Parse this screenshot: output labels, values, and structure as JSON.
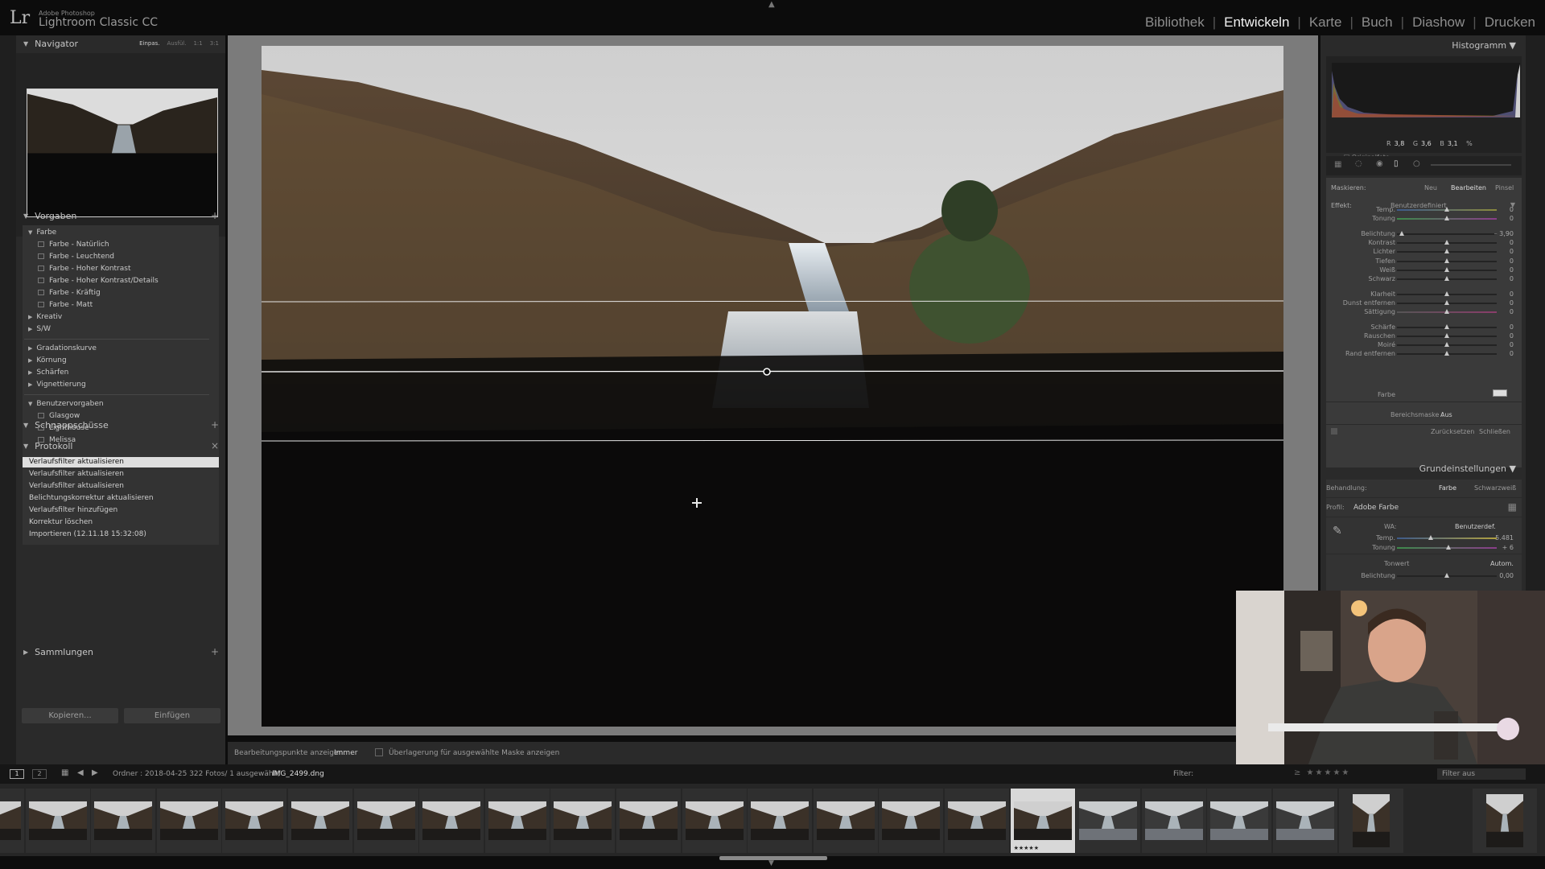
{
  "app": {
    "logo": "Lr",
    "brand_sub": "Adobe Photoshop",
    "brand_main": "Lightroom Classic CC"
  },
  "modules": [
    "Bibliothek",
    "Entwickeln",
    "Karte",
    "Buch",
    "Diashow",
    "Drucken"
  ],
  "active_module": "Entwickeln",
  "left_panel": {
    "navigator": {
      "title": "Navigator",
      "options": [
        "Einpas.",
        "Ausfül.",
        "1:1",
        "3:1"
      ]
    },
    "presets": {
      "title": "Vorgaben",
      "groups": [
        {
          "label": "Farbe",
          "items": [
            "Farbe - Natürlich",
            "Farbe - Leuchtend",
            "Farbe - Hoher Kontrast",
            "Farbe - Hoher Kontrast/Details",
            "Farbe - Kräftig",
            "Farbe - Matt"
          ]
        },
        {
          "label": "Kreativ"
        },
        {
          "label": "S/W"
        },
        {
          "label": "Gradationskurve"
        },
        {
          "label": "Körnung"
        },
        {
          "label": "Schärfen"
        },
        {
          "label": "Vignettierung"
        },
        {
          "label": "Benutzervorgaben",
          "items": [
            "Glasgow",
            "Lighthouse",
            "Melissa"
          ]
        }
      ]
    },
    "snapshots": {
      "title": "Schnappschüsse"
    },
    "history": {
      "title": "Protokoll",
      "items": [
        "Verlaufsfilter aktualisieren",
        "Verlaufsfilter aktualisieren",
        "Verlaufsfilter aktualisieren",
        "Belichtungskorrektur aktualisieren",
        "Verlaufsfilter hinzufügen",
        "Korrektur löschen",
        "Importieren (12.11.18 15:32:08)"
      ]
    },
    "collections": {
      "title": "Sammlungen"
    },
    "copy_button": "Kopieren...",
    "paste_button": "Einfügen"
  },
  "toolbar": {
    "edit_points_label": "Bearbeitungspunkte anzeigen:",
    "edit_points_value": "Immer",
    "overlay_label": "Überlagerung für ausgewählte Maske anzeigen"
  },
  "right_panel": {
    "histogram": {
      "title": "Histogramm",
      "r_label": "R",
      "r_value": "3,8",
      "g_label": "G",
      "g_value": "3,6",
      "b_label": "B",
      "b_value": "3,1",
      "unit": "%",
      "original_photo": "Originalfoto"
    },
    "mask": {
      "label": "Maskieren:",
      "tabs": [
        "Neu",
        "Bearbeiten",
        "Pinsel"
      ],
      "active_tab": "Bearbeiten",
      "effect_label": "Effekt:",
      "effect_value": "Benutzerdefiniert",
      "sliders": [
        {
          "label": "Temp.",
          "value": "0",
          "pos": 0.5
        },
        {
          "label": "Tonung",
          "value": "0",
          "pos": 0.5
        },
        {
          "label": "Belichtung",
          "value": "– 3,90",
          "pos": 0.05
        },
        {
          "label": "Kontrast",
          "value": "0",
          "pos": 0.5
        },
        {
          "label": "Lichter",
          "value": "0",
          "pos": 0.5
        },
        {
          "label": "Tiefen",
          "value": "0",
          "pos": 0.5
        },
        {
          "label": "Weiß",
          "value": "0",
          "pos": 0.5
        },
        {
          "label": "Schwarz",
          "value": "0",
          "pos": 0.5
        },
        {
          "label": "Klarheit",
          "value": "0",
          "pos": 0.5
        },
        {
          "label": "Dunst entfernen",
          "value": "0",
          "pos": 0.5
        },
        {
          "label": "Sättigung",
          "value": "0",
          "pos": 0.5
        },
        {
          "label": "Schärfe",
          "value": "0",
          "pos": 0.5
        },
        {
          "label": "Rauschen",
          "value": "0",
          "pos": 0.5
        },
        {
          "label": "Moiré",
          "value": "0",
          "pos": 0.5
        },
        {
          "label": "Rand entfernen",
          "value": "0",
          "pos": 0.5
        }
      ],
      "color_label": "Farbe",
      "range_mask_label": "Bereichsmaske :",
      "range_mask_value": "Aus",
      "reset": "Zurücksetzen",
      "close": "Schließen"
    },
    "basic": {
      "title": "Grundeinstellungen",
      "treatment_label": "Behandlung:",
      "treatment_color": "Farbe",
      "treatment_bw": "Schwarzweiß",
      "profile_label": "Profil:",
      "profile_value": "Adobe Farbe",
      "wb_label": "WA:",
      "wb_value": "Benutzerdef.",
      "temp_label": "Temp.",
      "temp_value": "5.481",
      "temp_pos": 0.34,
      "tint_label": "Tonung",
      "tint_value": "+ 6",
      "tint_pos": 0.52,
      "tone_label": "Tonwert",
      "tone_auto": "Autom.",
      "exposure_label": "Belichtung",
      "exposure_value": "0,00",
      "exposure_pos": 0.5
    }
  },
  "filmstrip": {
    "page1": "1",
    "page2": "2",
    "folder_info": "Ordner : 2018-04-25   322 Fotos/  1 ausgewählt/",
    "filename": "IMG_2499.dng",
    "filter_label": "Filter:",
    "filter_value": "Filter aus",
    "selected_rating_stars": "★★★★★",
    "selected_index": 16,
    "thumb_count": 23
  }
}
